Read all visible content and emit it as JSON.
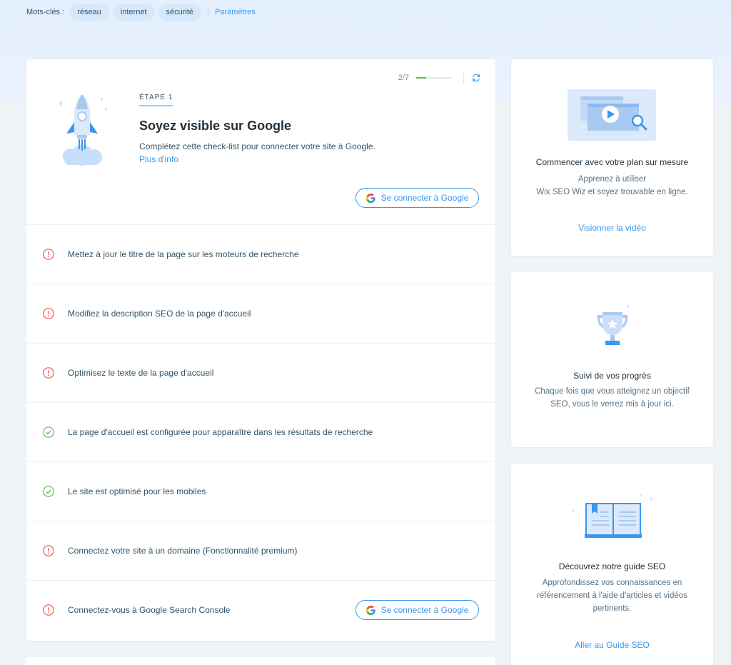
{
  "keywords": {
    "label": "Mots-clés :",
    "chips": [
      "réseau",
      "internet",
      "sécurité"
    ],
    "settings_label": "Paramètres"
  },
  "checklist_card": {
    "progress_text": "2/7",
    "progress_fraction": 0.2857,
    "step_label": "ÉTAPE 1",
    "title": "Soyez visible sur Google",
    "description": "Complétez cette check-list pour connecter votre site à Google.",
    "more_info": "Plus d'info",
    "connect_button": "Se connecter à Google",
    "items": [
      {
        "label": "Mettez à jour le titre de la page sur les moteurs de recherche",
        "status": "todo"
      },
      {
        "label": "Modifiez la description SEO de la page d'accueil",
        "status": "todo"
      },
      {
        "label": "Optimisez le texte de la page d'accueil",
        "status": "todo"
      },
      {
        "label": "La page d'accueil est configurée pour apparaître dans les résultats de recherche",
        "status": "done"
      },
      {
        "label": "Le site est optimisé pour les mobiles",
        "status": "done"
      },
      {
        "label": "Connectez votre site à un domaine (Fonctionnalité premium)",
        "status": "todo"
      },
      {
        "label": "Connectez-vous à Google Search Console",
        "status": "todo",
        "button": "Se connecter à Google"
      }
    ]
  },
  "video_card": {
    "title": "Commencer avec votre plan sur mesure",
    "text_line1": "Apprenez à utiliser",
    "text_line2": "Wix SEO Wiz et soyez trouvable en ligne.",
    "link": "Visionner la vidéo"
  },
  "progress_card": {
    "title": "Suivi de vos progrès",
    "text": "Chaque fois que vous atteignez un objectif SEO, vous le verrez mis à jour ici."
  },
  "guide_card": {
    "title": "Découvrez notre guide SEO",
    "text": "Approfondissez vos connaissances en référencement à l'aide d'articles et vidéos pertinents.",
    "link": "Aller au Guide SEO"
  },
  "colors": {
    "accent": "#3899ec",
    "todo": "#ee5951",
    "done": "#60bc57"
  }
}
